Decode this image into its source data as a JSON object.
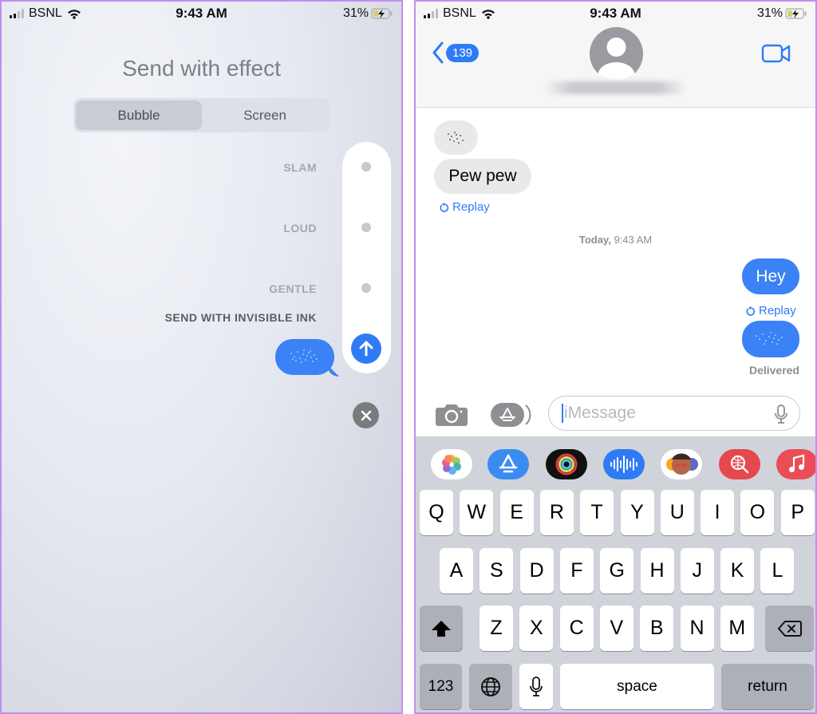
{
  "left": {
    "status": {
      "carrier": "BSNL",
      "time": "9:43 AM",
      "battery": "31%"
    },
    "title": "Send with effect",
    "tabs": [
      {
        "label": "Bubble",
        "active": true
      },
      {
        "label": "Screen",
        "active": false
      }
    ],
    "effects": [
      {
        "label": "SLAM"
      },
      {
        "label": "LOUD"
      },
      {
        "label": "GENTLE"
      },
      {
        "label": "SEND WITH INVISIBLE INK",
        "selected": true
      }
    ],
    "icons": {
      "send": "arrow-up-icon",
      "close": "close-icon"
    }
  },
  "right": {
    "status": {
      "carrier": "BSNL",
      "time": "9:43 AM",
      "battery": "31%"
    },
    "nav": {
      "back_count": "139",
      "contact_name_blurred": true,
      "video_icon": "video-camera-icon"
    },
    "messages": [
      {
        "direction": "incoming",
        "type": "invisible-ink"
      },
      {
        "direction": "incoming",
        "text": "Pew pew",
        "replay": "Replay"
      },
      {
        "direction": "timestamp",
        "day": "Today,",
        "time": "9:43 AM"
      },
      {
        "direction": "outgoing",
        "text": "Hey",
        "replay": "Replay"
      },
      {
        "direction": "outgoing",
        "type": "invisible-ink",
        "status": "Delivered"
      }
    ],
    "input": {
      "placeholder": "iMessage"
    },
    "app_strip": [
      "photos",
      "app-store",
      "activity",
      "audio",
      "memoji",
      "web-search",
      "music"
    ],
    "keyboard": {
      "row1": [
        "Q",
        "W",
        "E",
        "R",
        "T",
        "Y",
        "U",
        "I",
        "O",
        "P"
      ],
      "row2": [
        "A",
        "S",
        "D",
        "F",
        "G",
        "H",
        "J",
        "K",
        "L"
      ],
      "row3": [
        "Z",
        "X",
        "C",
        "V",
        "B",
        "N",
        "M"
      ],
      "numbers": "123",
      "space": "space",
      "return": "return"
    },
    "colors": {
      "accent": "#2f7bf5",
      "outgoing_bubble": "#3a82f6",
      "incoming_bubble": "#e9e9eb"
    }
  }
}
